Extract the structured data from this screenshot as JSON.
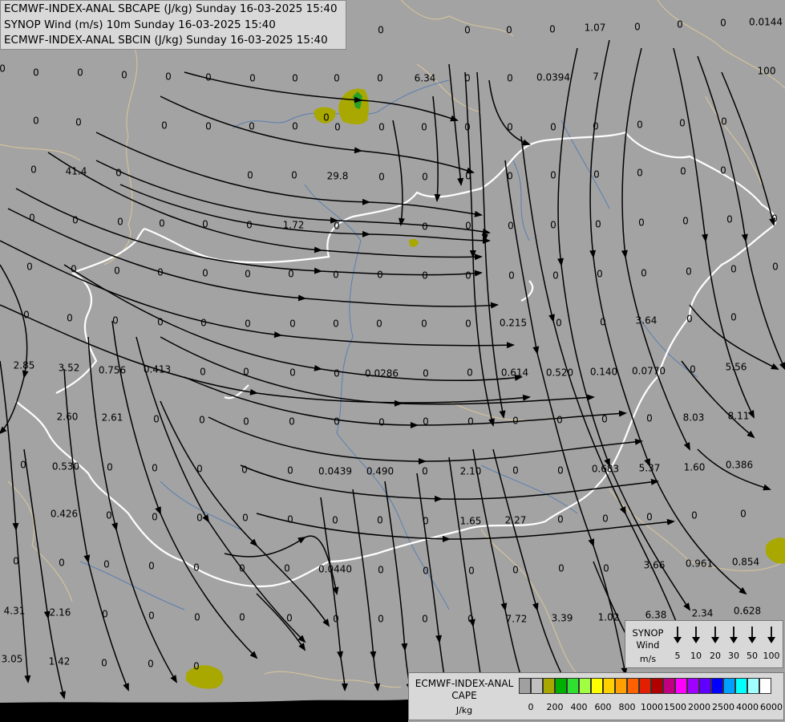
{
  "header": {
    "line1": "ECMWF-INDEX-ANAL SBCAPE (J/kg) Sunday 16-03-2025 15:40",
    "line2": "SYNOP Wind (m/s) 10m Sunday 16-03-2025 15:40",
    "line3": "ECMWF-INDEX-ANAL SBCIN (J/kg) Sunday 16-03-2025 15:40"
  },
  "colors": {
    "land": "#a3a3a3",
    "streamline": "#000000",
    "border": "#ffffff",
    "river": "#5b7fb0",
    "province_line": "#d6c49a",
    "cape_low": "#a8a800",
    "cape_mid": "#28a028",
    "sea_bottom": "#000000"
  },
  "map": {
    "values": [
      {
        "t": "0"
      },
      {
        "t": "0"
      },
      {
        "t": "0"
      },
      {
        "t": "0"
      },
      {
        "t": "1.07"
      },
      {
        "t": "0"
      },
      {
        "t": "0"
      },
      {
        "t": "0.0144"
      },
      {
        "t": "0"
      },
      {
        "t": "0"
      },
      {
        "t": "0"
      },
      {
        "t": "0"
      },
      {
        "t": "0"
      },
      {
        "t": "0"
      },
      {
        "t": "0"
      },
      {
        "t": "0"
      },
      {
        "t": "0"
      },
      {
        "t": "0"
      },
      {
        "t": "6.34"
      },
      {
        "t": "0"
      },
      {
        "t": "0"
      },
      {
        "t": "0.0394"
      },
      {
        "t": "7"
      },
      {
        "t": "100"
      },
      {
        "t": "0"
      },
      {
        "t": "0"
      },
      {
        "t": "0"
      },
      {
        "t": "0"
      },
      {
        "t": "0"
      },
      {
        "t": "0"
      },
      {
        "t": "0"
      },
      {
        "t": "0"
      },
      {
        "t": "0"
      },
      {
        "t": "0"
      },
      {
        "t": "0"
      },
      {
        "t": "0"
      },
      {
        "t": "0"
      },
      {
        "t": "0"
      },
      {
        "t": "0"
      },
      {
        "t": "0"
      },
      {
        "t": "0"
      },
      {
        "t": "0"
      },
      {
        "t": "0"
      },
      {
        "t": "41.4"
      },
      {
        "t": "0"
      },
      {
        "t": "0"
      },
      {
        "t": "0"
      },
      {
        "t": "29.8"
      },
      {
        "t": "0"
      },
      {
        "t": "0"
      },
      {
        "t": "0"
      },
      {
        "t": "0"
      },
      {
        "t": "0"
      },
      {
        "t": "0"
      },
      {
        "t": "0"
      },
      {
        "t": "0"
      },
      {
        "t": "0"
      },
      {
        "t": "0"
      },
      {
        "t": "0"
      },
      {
        "t": "0"
      },
      {
        "t": "0"
      },
      {
        "t": "0"
      },
      {
        "t": "0"
      },
      {
        "t": "1.72"
      },
      {
        "t": "0"
      },
      {
        "t": "0"
      },
      {
        "t": "0"
      },
      {
        "t": "0"
      },
      {
        "t": "0"
      },
      {
        "t": "0"
      },
      {
        "t": "0"
      },
      {
        "t": "0"
      },
      {
        "t": "0"
      },
      {
        "t": "0"
      },
      {
        "t": "0"
      },
      {
        "t": "0"
      },
      {
        "t": "0"
      },
      {
        "t": "0"
      },
      {
        "t": "0"
      },
      {
        "t": "0"
      },
      {
        "t": "0"
      },
      {
        "t": "0"
      },
      {
        "t": "0"
      },
      {
        "t": "0"
      },
      {
        "t": "0"
      },
      {
        "t": "0"
      },
      {
        "t": "0"
      },
      {
        "t": "0"
      },
      {
        "t": "0"
      },
      {
        "t": "0"
      },
      {
        "t": "0"
      },
      {
        "t": "0"
      },
      {
        "t": "0"
      },
      {
        "t": "0"
      },
      {
        "t": "0"
      },
      {
        "t": "0"
      },
      {
        "t": "0"
      },
      {
        "t": "0"
      },
      {
        "t": "0"
      },
      {
        "t": "0"
      },
      {
        "t": "0"
      },
      {
        "t": "0"
      },
      {
        "t": "0"
      },
      {
        "t": "0.215"
      },
      {
        "t": "0"
      },
      {
        "t": "0"
      },
      {
        "t": "3.64"
      },
      {
        "t": "0"
      },
      {
        "t": "0"
      },
      {
        "t": "2.85"
      },
      {
        "t": "3.52"
      },
      {
        "t": "0.756"
      },
      {
        "t": "0.413"
      },
      {
        "t": "0"
      },
      {
        "t": "0"
      },
      {
        "t": "0"
      },
      {
        "t": "0"
      },
      {
        "t": "0.0286"
      },
      {
        "t": "0"
      },
      {
        "t": "0"
      },
      {
        "t": "0.614"
      },
      {
        "t": "0.520"
      },
      {
        "t": "0.140"
      },
      {
        "t": "0.0770"
      },
      {
        "t": "0"
      },
      {
        "t": "5.56"
      },
      {
        "t": "2.60"
      },
      {
        "t": "2.61"
      },
      {
        "t": "0"
      },
      {
        "t": "0"
      },
      {
        "t": "0"
      },
      {
        "t": "0"
      },
      {
        "t": "0"
      },
      {
        "t": "0"
      },
      {
        "t": "0"
      },
      {
        "t": "0"
      },
      {
        "t": "0"
      },
      {
        "t": "0"
      },
      {
        "t": "0"
      },
      {
        "t": "0"
      },
      {
        "t": "8.03"
      },
      {
        "t": "8.11"
      },
      {
        "t": "0"
      },
      {
        "t": "0.530"
      },
      {
        "t": "0"
      },
      {
        "t": "0"
      },
      {
        "t": "0"
      },
      {
        "t": "0"
      },
      {
        "t": "0"
      },
      {
        "t": "0.0439"
      },
      {
        "t": "0.490"
      },
      {
        "t": "0"
      },
      {
        "t": "2.10"
      },
      {
        "t": "0"
      },
      {
        "t": "0"
      },
      {
        "t": "0.683"
      },
      {
        "t": "5.37"
      },
      {
        "t": "1.60"
      },
      {
        "t": "0.386"
      },
      {
        "t": "0.426"
      },
      {
        "t": "0"
      },
      {
        "t": "0"
      },
      {
        "t": "0"
      },
      {
        "t": "0"
      },
      {
        "t": "0"
      },
      {
        "t": "0"
      },
      {
        "t": "0"
      },
      {
        "t": "0"
      },
      {
        "t": "1.65"
      },
      {
        "t": "2.27"
      },
      {
        "t": "0"
      },
      {
        "t": "0"
      },
      {
        "t": "0"
      },
      {
        "t": "0"
      },
      {
        "t": "0"
      },
      {
        "t": "0"
      },
      {
        "t": "0"
      },
      {
        "t": "0"
      },
      {
        "t": "0"
      },
      {
        "t": "0"
      },
      {
        "t": "0"
      },
      {
        "t": "0"
      },
      {
        "t": "0.0440"
      },
      {
        "t": "0"
      },
      {
        "t": "0"
      },
      {
        "t": "0"
      },
      {
        "t": "0"
      },
      {
        "t": "0"
      },
      {
        "t": "0"
      },
      {
        "t": "3.66"
      },
      {
        "t": "0.961"
      },
      {
        "t": "0.854"
      },
      {
        "t": "4.31"
      },
      {
        "t": "2.16"
      },
      {
        "t": "0"
      },
      {
        "t": "0"
      },
      {
        "t": "0"
      },
      {
        "t": "0"
      },
      {
        "t": "0"
      },
      {
        "t": "0"
      },
      {
        "t": "0"
      },
      {
        "t": "0"
      },
      {
        "t": "0"
      },
      {
        "t": "7.72"
      },
      {
        "t": "3.39"
      },
      {
        "t": "1.02"
      },
      {
        "t": "6.38"
      },
      {
        "t": "2.34"
      },
      {
        "t": "0.628"
      },
      {
        "t": "3.05"
      },
      {
        "t": "1.42"
      },
      {
        "t": "0"
      },
      {
        "t": "0"
      },
      {
        "t": "0"
      }
    ]
  },
  "synop_legend": {
    "title_line1": "SYNOP",
    "title_line2": "Wind",
    "unit": "m/s",
    "speeds": [
      "5",
      "10",
      "20",
      "30",
      "50",
      "100"
    ]
  },
  "cape_legend": {
    "name_line1": "ECMWF-INDEX-ANAL",
    "name_line2": "CAPE",
    "unit": "J/kg",
    "ticks": [
      "0",
      "200",
      "400",
      "600",
      "800",
      "1000",
      "1500",
      "2000",
      "2500",
      "4000",
      "6000"
    ],
    "colors": [
      "#a0a0a0",
      "#c0c0c0",
      "#a8a800",
      "#00b000",
      "#30e030",
      "#a0ff40",
      "#ffff00",
      "#ffd000",
      "#ffa000",
      "#ff6000",
      "#e02000",
      "#b00000",
      "#c00080",
      "#ff00ff",
      "#a000ff",
      "#6000ff",
      "#0000ff",
      "#00a0ff",
      "#00ffff",
      "#a0ffff",
      "#ffffff"
    ]
  }
}
